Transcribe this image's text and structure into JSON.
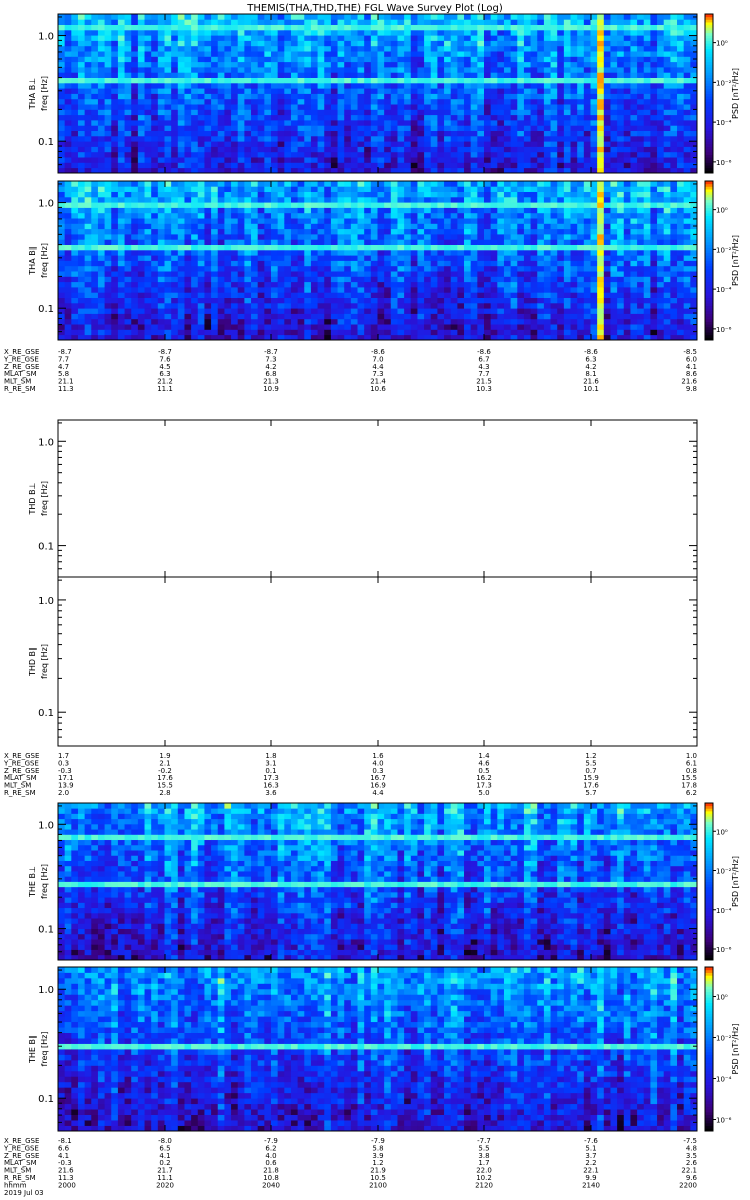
{
  "title": "THEMIS(THA,THD,THE) FGL Wave Survey Plot (Log)",
  "freq_ticks": [
    "1.0",
    "0.1"
  ],
  "colorbar": {
    "label": "PSD [nT²/Hz]",
    "tick_labels": [
      "10⁰",
      "10⁻²",
      "10⁻⁴",
      "10⁻⁶"
    ],
    "colors": [
      "#000000",
      "#4b0082",
      "#0000ff",
      "#00aaff",
      "#00ffff",
      "#00ff66",
      "#ffff00",
      "#ff8800",
      "#ff0000",
      "#aa0000"
    ]
  },
  "chart_data": [
    {
      "type": "heatmap",
      "probe": "THA",
      "component": "B⊥",
      "ylabel": "THA B⊥",
      "ylabel2": "freq [Hz]",
      "ylim": [
        0.05,
        1.6
      ],
      "yscale": "log",
      "has_data": true,
      "features": {
        "bright_band_freqs": [
          1.15,
          0.38
        ],
        "spike_time_fraction": 0.85
      }
    },
    {
      "type": "heatmap",
      "probe": "THA",
      "component": "B∥",
      "ylabel": "THA B∥",
      "ylabel2": "freq [Hz]",
      "ylim": [
        0.05,
        1.6
      ],
      "yscale": "log",
      "has_data": true,
      "features": {
        "bright_band_freqs": [
          1.0,
          0.38
        ],
        "spike_time_fraction": 0.85
      }
    },
    {
      "type": "heatmap",
      "probe": "THD",
      "component": "B⊥",
      "ylabel": "THD B⊥",
      "ylabel2": "freq [Hz]",
      "ylim": [
        0.05,
        1.6
      ],
      "yscale": "log",
      "has_data": false
    },
    {
      "type": "heatmap",
      "probe": "THD",
      "component": "B∥",
      "ylabel": "THD B∥",
      "ylabel2": "freq [Hz]",
      "ylim": [
        0.05,
        1.6
      ],
      "yscale": "log",
      "has_data": false
    },
    {
      "type": "heatmap",
      "probe": "THE",
      "component": "B⊥",
      "ylabel": "THE B⊥",
      "ylabel2": "freq [Hz]",
      "ylim": [
        0.05,
        1.6
      ],
      "yscale": "log",
      "has_data": true,
      "features": {
        "bright_band_freqs": [
          0.75,
          0.28
        ],
        "spike_time_fraction": null
      }
    },
    {
      "type": "heatmap",
      "probe": "THE",
      "component": "B∥",
      "ylabel": "THE B∥",
      "ylabel2": "freq [Hz]",
      "ylim": [
        0.05,
        1.6
      ],
      "yscale": "log",
      "has_data": true,
      "features": {
        "bright_band_freqs": [
          0.3
        ],
        "spike_time_fraction": null
      }
    }
  ],
  "ephemeris": [
    {
      "probe": "THA",
      "rows": [
        {
          "name": "X_RE_GSE",
          "values": [
            "-8.7",
            "-8.7",
            "-8.7",
            "-8.6",
            "-8.6",
            "-8.6",
            "-8.5"
          ]
        },
        {
          "name": "Y_RE_GSE",
          "values": [
            "7.7",
            "7.6",
            "7.3",
            "7.0",
            "6.7",
            "6.3",
            "6.0"
          ]
        },
        {
          "name": "Z_RE_GSE",
          "values": [
            "4.7",
            "4.5",
            "4.2",
            "4.4",
            "4.3",
            "4.2",
            "4.1"
          ]
        },
        {
          "name": "MLAT_SM",
          "values": [
            "5.8",
            "6.3",
            "6.8",
            "7.3",
            "7.7",
            "8.1",
            "8.6"
          ]
        },
        {
          "name": "MLT_SM",
          "values": [
            "21.1",
            "21.2",
            "21.3",
            "21.4",
            "21.5",
            "21.6",
            "21.6"
          ]
        },
        {
          "name": "R_RE_SM",
          "values": [
            "11.3",
            "11.1",
            "10.9",
            "10.6",
            "10.3",
            "10.1",
            "9.8"
          ]
        }
      ]
    },
    {
      "probe": "THD",
      "rows": [
        {
          "name": "X_RE_GSE",
          "values": [
            "1.7",
            "1.9",
            "1.8",
            "1.6",
            "1.4",
            "1.2",
            "1.0"
          ]
        },
        {
          "name": "Y_RE_GSE",
          "values": [
            "0.3",
            "2.1",
            "3.1",
            "4.0",
            "4.6",
            "5.5",
            "6.1"
          ]
        },
        {
          "name": "Z_RE_GSE",
          "values": [
            "-0.3",
            "-0.2",
            "0.1",
            "0.3",
            "0.5",
            "0.7",
            "0.8"
          ]
        },
        {
          "name": "MLAT_SM",
          "values": [
            "17.1",
            "17.6",
            "17.3",
            "16.7",
            "16.2",
            "15.9",
            "15.5"
          ]
        },
        {
          "name": "MLT_SM",
          "values": [
            "13.9",
            "15.5",
            "16.3",
            "16.9",
            "17.3",
            "17.6",
            "17.8"
          ]
        },
        {
          "name": "R_RE_SM",
          "values": [
            "2.0",
            "2.8",
            "3.6",
            "4.4",
            "5.0",
            "5.7",
            "6.2"
          ]
        }
      ]
    },
    {
      "probe": "THE",
      "rows": [
        {
          "name": "X_RE_GSE",
          "values": [
            "-8.1",
            "-8.0",
            "-7.9",
            "-7.9",
            "-7.7",
            "-7.6",
            "-7.5"
          ]
        },
        {
          "name": "Y_RE_GSE",
          "values": [
            "6.6",
            "6.5",
            "6.2",
            "5.8",
            "5.5",
            "5.1",
            "4.8"
          ]
        },
        {
          "name": "Z_RE_GSE",
          "values": [
            "4.1",
            "4.1",
            "4.0",
            "3.9",
            "3.8",
            "3.7",
            "3.5"
          ]
        },
        {
          "name": "MLAT_SM",
          "values": [
            "-0.3",
            "0.2",
            "0.6",
            "1.2",
            "1.7",
            "2.2",
            "2.6"
          ]
        },
        {
          "name": "MLT_SM",
          "values": [
            "21.6",
            "21.7",
            "21.8",
            "21.9",
            "22.0",
            "22.1",
            "22.1"
          ]
        },
        {
          "name": "R_RE_SM",
          "values": [
            "11.3",
            "11.1",
            "10.8",
            "10.5",
            "10.2",
            "9.9",
            "9.6"
          ]
        },
        {
          "name": "hhmm",
          "values": [
            "2000",
            "2020",
            "2040",
            "2100",
            "2120",
            "2140",
            "2200"
          ]
        }
      ],
      "date": "2019 Jul 03"
    }
  ]
}
